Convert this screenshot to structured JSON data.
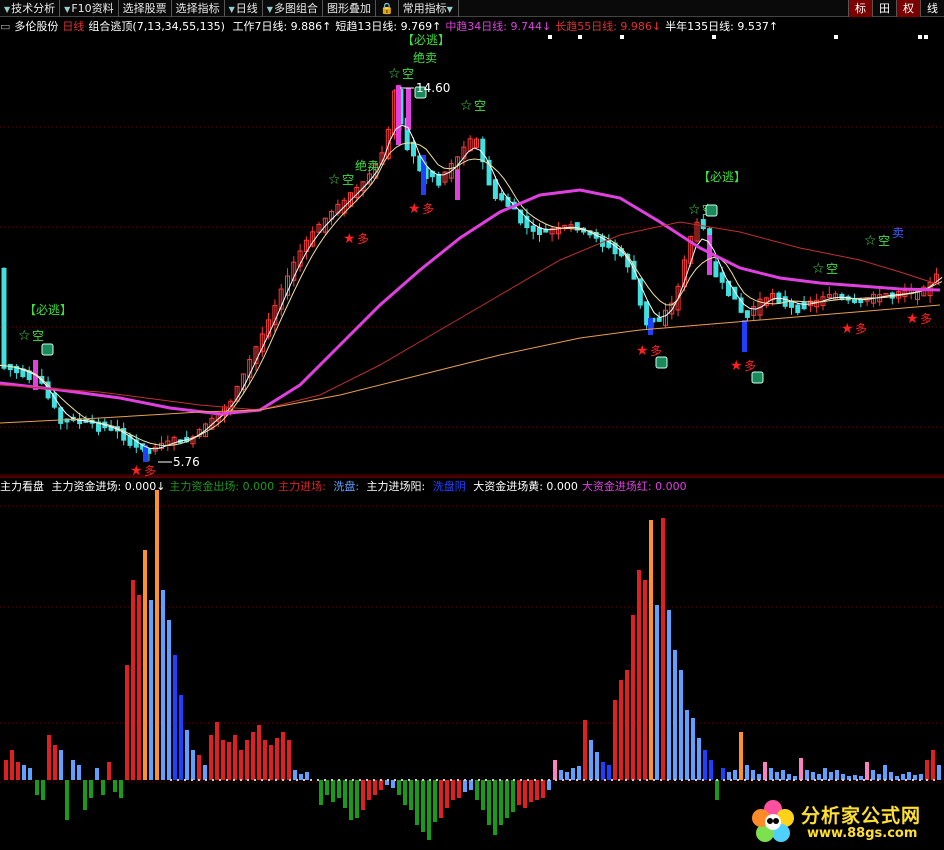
{
  "toolbar": {
    "items": [
      "技术分析",
      "F10资料",
      "选择股票",
      "选择指标",
      "日线",
      "多图组合",
      "图形叠加",
      "常用指标"
    ],
    "right_buttons": [
      "标",
      "田",
      "权",
      "线"
    ]
  },
  "price_panel": {
    "stock": "多伦股份",
    "period": "日线",
    "indicator": "组合逃顶(7,13,34,55,135)",
    "ma_lines": [
      {
        "label": "工作7日线:",
        "value": "9.886",
        "arrow": "↑",
        "color": "#ffffff"
      },
      {
        "label": "短趋13日线:",
        "value": "9.769",
        "arrow": "↑",
        "color": "#ffffff"
      },
      {
        "label": "中趋34日线:",
        "value": "9.744",
        "arrow": "↓",
        "color": "#e040e0"
      },
      {
        "label": "长趋55日线:",
        "value": "9.986",
        "arrow": "↓",
        "color": "#e03030"
      },
      {
        "label": "半年135日线:",
        "value": "9.537",
        "arrow": "↑",
        "color": "#ffffff"
      }
    ],
    "price_high": "14.60",
    "price_low": "5.76",
    "signals": {
      "empty": "空",
      "long": "多",
      "must_escape": "【必逃】",
      "sell_all": "绝卖",
      "sell": "卖"
    }
  },
  "volume_panel": {
    "title": "主力看盘",
    "fields": [
      {
        "label": "主力资金进场:",
        "value": "0.000",
        "arrow": "↓",
        "color": "#ffffff"
      },
      {
        "label": "主力资金出场:",
        "value": "0.000",
        "arrow": "",
        "color": "#1a9a1a"
      },
      {
        "label": "主力进场:",
        "value": "",
        "arrow": "",
        "color": "#e02020"
      },
      {
        "label": "洗盘:",
        "value": "",
        "arrow": "",
        "color": "#60a0ff"
      },
      {
        "label": "主力进场阳:",
        "value": "",
        "arrow": "",
        "color": "#ffffff"
      },
      {
        "label": "洗盘阴",
        "value": "",
        "arrow": "",
        "color": "#2040ff"
      },
      {
        "label": "大资金进场黄:",
        "value": "0.000",
        "arrow": "",
        "color": "#ffffff"
      },
      {
        "label": "大资金进场红:",
        "value": "0.000",
        "arrow": "",
        "color": "#e040e0"
      }
    ]
  },
  "watermark": {
    "name": "分析家公式网",
    "url": "www.88gs.com"
  },
  "colors": {
    "up": "#ff3a3a",
    "down": "#40e0e0",
    "ma34": "#e040e0",
    "ma55": "#c03030",
    "ma135": "#e8a050",
    "ma7": "#ffffff",
    "ma13": "#f0e0a0"
  }
}
